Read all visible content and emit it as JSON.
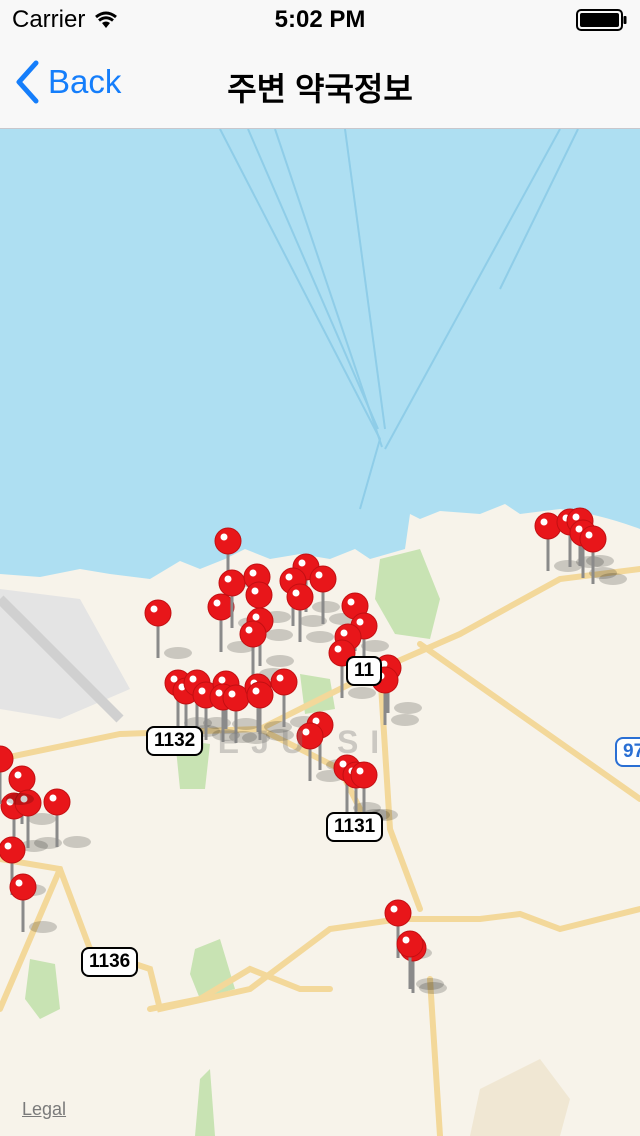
{
  "status": {
    "carrier": "Carrier",
    "time": "5:02 PM"
  },
  "nav": {
    "back_label": "Back",
    "title": "주변 약국정보"
  },
  "map": {
    "city_label": "JEJU SI",
    "road_labels": [
      "1132",
      "1131",
      "1136",
      "11",
      "97"
    ],
    "legal": "Legal",
    "pin_color": "#e8161a",
    "sea_color": "#aedff2",
    "land_color": "#f7f3ea",
    "park_color": "#c8e3b3"
  }
}
